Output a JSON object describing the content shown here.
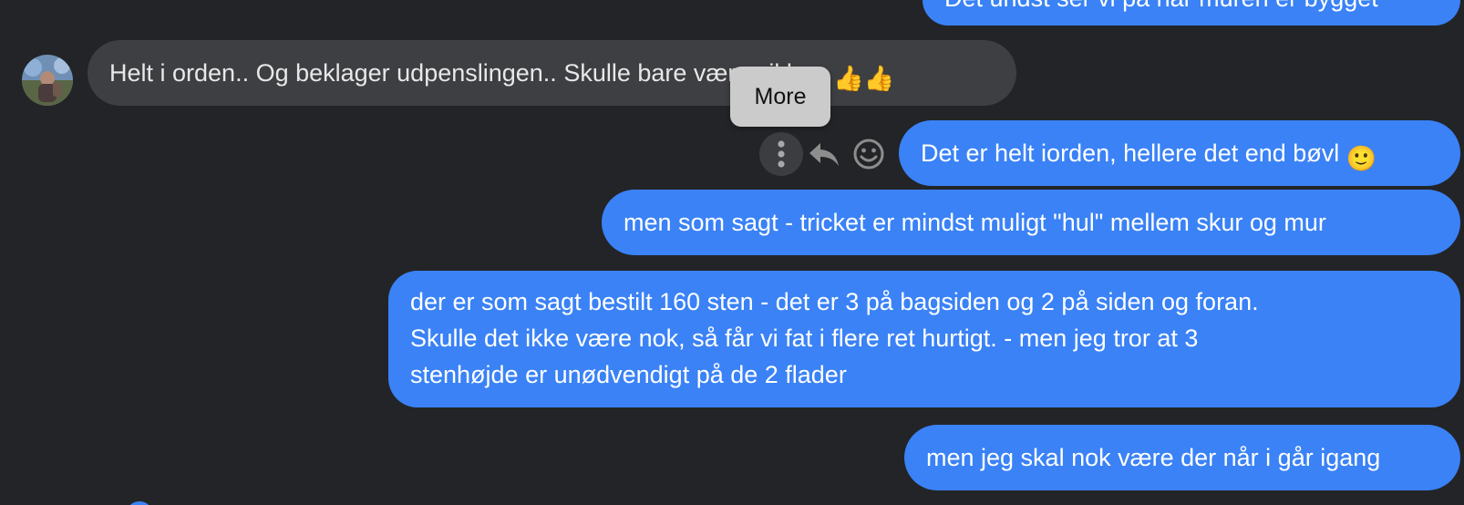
{
  "conversation": {
    "messages": [
      {
        "id": "m0",
        "direction": "outgoing",
        "text": "Det undst ser vi på når muren er bygget"
      },
      {
        "id": "m1",
        "direction": "incoming",
        "text": "Helt i orden.. Og beklager udpenslingen.. Skulle bare være sikker.",
        "emoji": "👍👍"
      },
      {
        "id": "m2",
        "direction": "outgoing",
        "text": "Det er helt iorden, hellere det end bøvl",
        "emoji": "🙂"
      },
      {
        "id": "m3",
        "direction": "outgoing",
        "text": "men som sagt - tricket er mindst muligt \"hul\" mellem skur og mur"
      },
      {
        "id": "m4",
        "direction": "outgoing",
        "lines": [
          "der er som sagt bestilt 160 sten - det er 3 på bagsiden og 2 på siden og foran.",
          "Skulle det ikke være nok, så får vi fat i flere ret hurtigt. - men jeg tror at 3",
          "stenhøjde er unødvendigt på de 2 flader"
        ]
      },
      {
        "id": "m5",
        "direction": "outgoing",
        "text": "men jeg skal nok være der når i går igang"
      }
    ]
  },
  "tooltip": {
    "text": "More"
  },
  "message_actions": [
    {
      "icon": "more-vertical-icon",
      "active": true
    },
    {
      "icon": "reply-icon"
    },
    {
      "icon": "smiley-icon"
    }
  ],
  "colors": {
    "background": "#232427",
    "outgoing_bubble": "#3a82f6",
    "incoming_bubble": "#3e3f42",
    "tooltip": "#cbcbcb"
  }
}
